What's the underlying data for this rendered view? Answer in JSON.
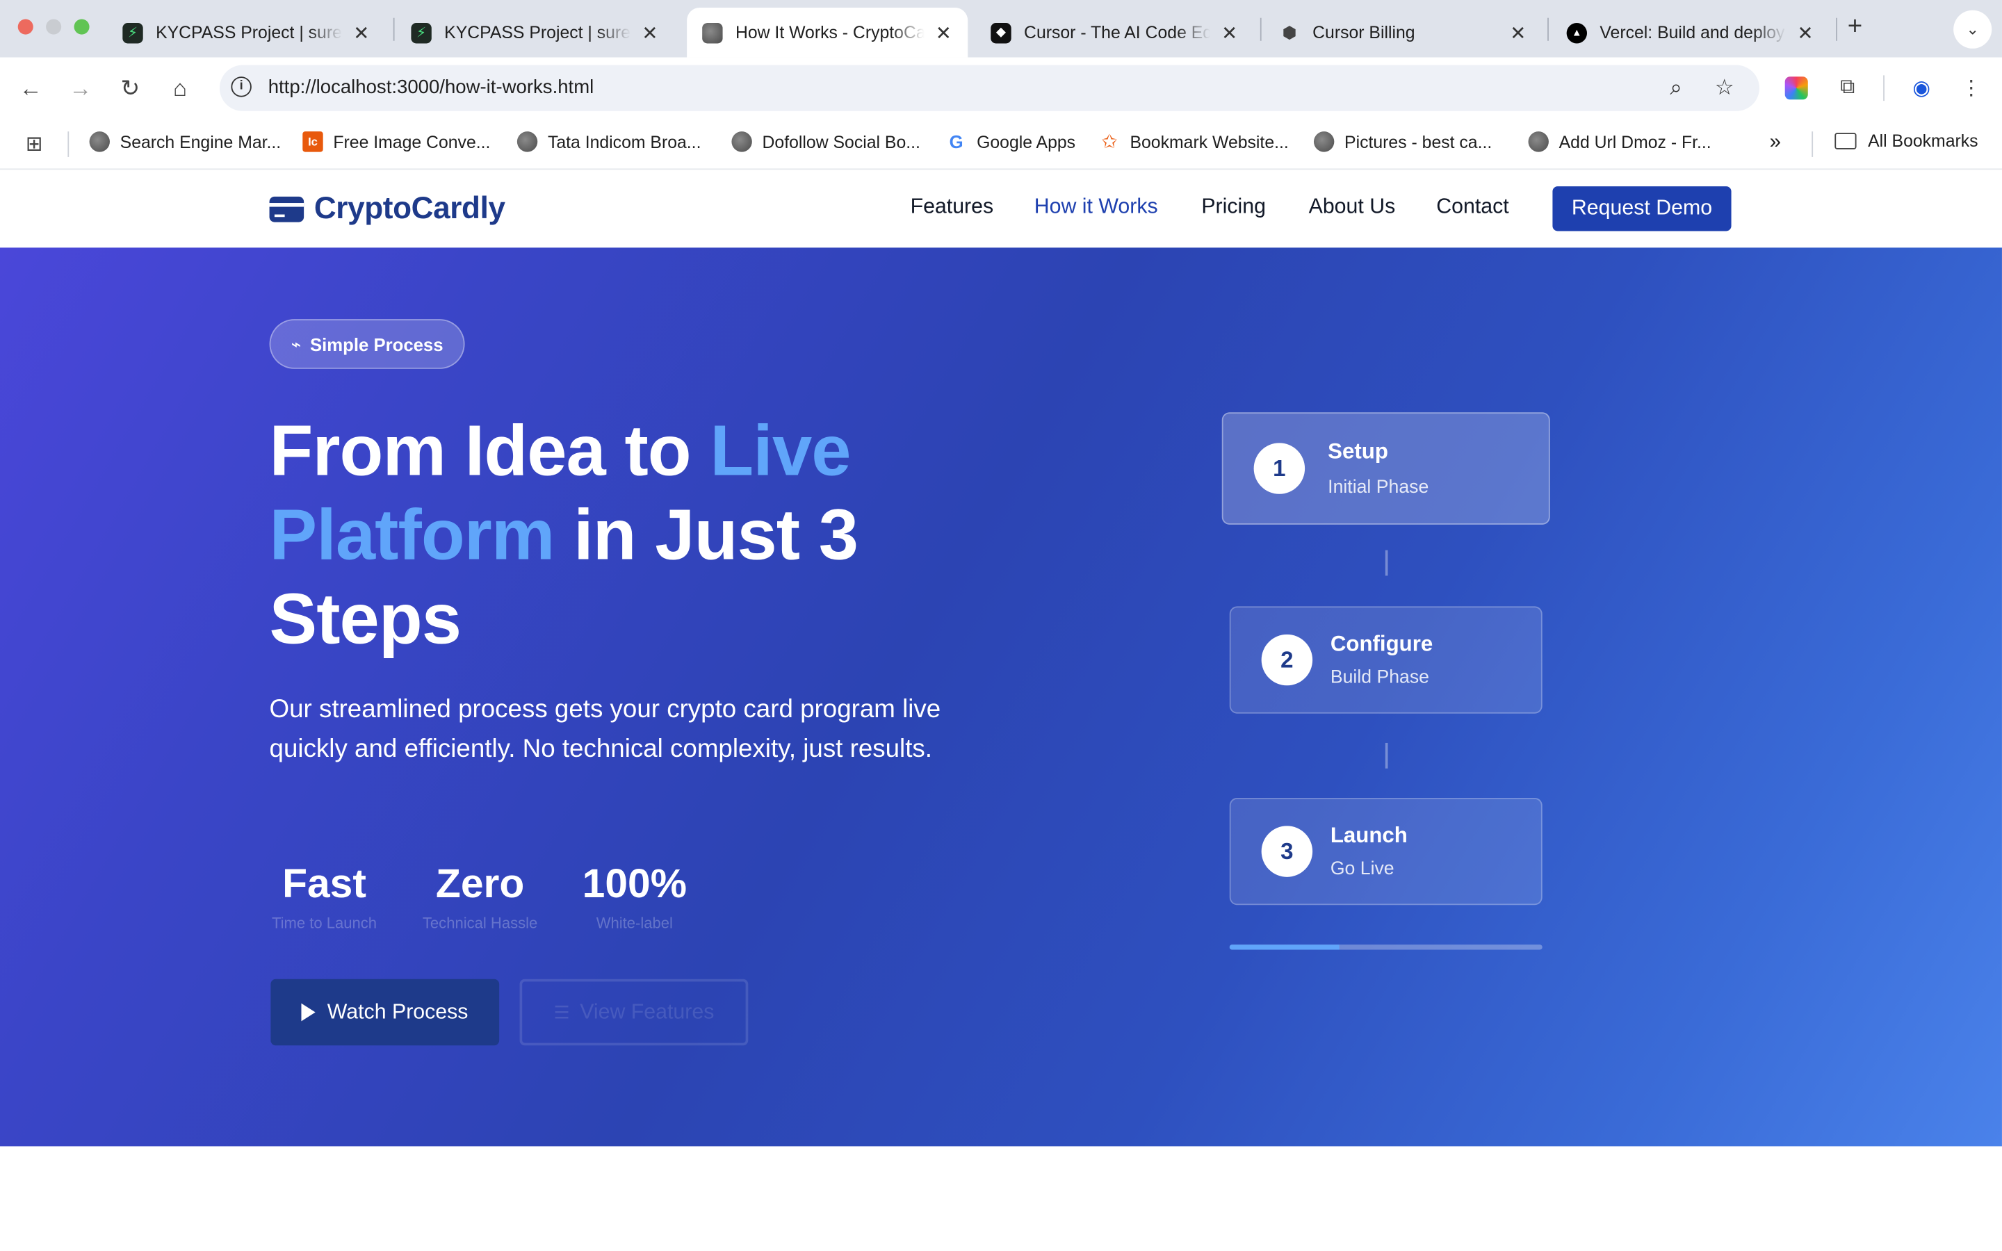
{
  "browser": {
    "tabs": [
      {
        "title": "KYCPASS Project | suresh",
        "favicon": "bolt-icon",
        "active": false
      },
      {
        "title": "KYCPASS Project | suresh",
        "favicon": "bolt-icon",
        "active": false
      },
      {
        "title": "How It Works - CryptoCardly",
        "favicon": "globe-icon",
        "active": true
      },
      {
        "title": "Cursor - The AI Code Editor",
        "favicon": "cursor-icon",
        "active": false
      },
      {
        "title": "Cursor Billing",
        "favicon": "cube-icon",
        "active": false
      },
      {
        "title": "Vercel: Build and deploy",
        "favicon": "triangle-icon",
        "active": false
      }
    ],
    "new_tab_label": "+",
    "close_glyph": "✕",
    "url": "http://localhost:3000/how-it-works.html",
    "bookmarks": [
      {
        "label": "Search Engine Mar...",
        "icon": "globe-icon"
      },
      {
        "label": "Free Image Conve...",
        "icon": "ic-icon"
      },
      {
        "label": "Tata Indicom Broa...",
        "icon": "globe-icon"
      },
      {
        "label": "Dofollow Social Bo...",
        "icon": "globe-icon"
      },
      {
        "label": "Google Apps",
        "icon": "google-icon"
      },
      {
        "label": "Bookmark Website...",
        "icon": "star-icon"
      },
      {
        "label": "Pictures - best ca...",
        "icon": "globe-icon"
      },
      {
        "label": "Add Url Dmoz - Fr...",
        "icon": "globe-icon"
      }
    ],
    "overflow_label": "»",
    "all_bookmarks_label": "All Bookmarks"
  },
  "site": {
    "brand": "CryptoCardly",
    "nav": [
      {
        "label": "Features",
        "active": false
      },
      {
        "label": "How it Works",
        "active": true
      },
      {
        "label": "Pricing",
        "active": false
      },
      {
        "label": "About Us",
        "active": false
      },
      {
        "label": "Contact",
        "active": false
      }
    ],
    "cta": "Request Demo"
  },
  "hero": {
    "badge": "Simple Process",
    "headline": {
      "part1": "From Idea to ",
      "highlight": "Live Platform",
      "part2": " in Just 3 Steps"
    },
    "subtitle": "Our streamlined process gets your crypto card program live quickly and efficiently. No technical complexity, just results.",
    "stats": [
      {
        "value": "Fast",
        "label": "Time to Launch"
      },
      {
        "value": "Zero",
        "label": "Technical Hassle"
      },
      {
        "value": "100%",
        "label": "White-label"
      }
    ],
    "primary_button": "Watch Process",
    "secondary_button": "View Features",
    "steps": [
      {
        "number": "1",
        "title": "Setup",
        "subtitle": "Initial Phase"
      },
      {
        "number": "2",
        "title": "Configure",
        "subtitle": "Build Phase"
      },
      {
        "number": "3",
        "title": "Launch",
        "subtitle": "Go Live"
      }
    ],
    "progress_fraction": 0.35
  },
  "colors": {
    "brand": "#1e3a8a",
    "accent": "#60a5fa",
    "nav_active": "#1e40af"
  }
}
